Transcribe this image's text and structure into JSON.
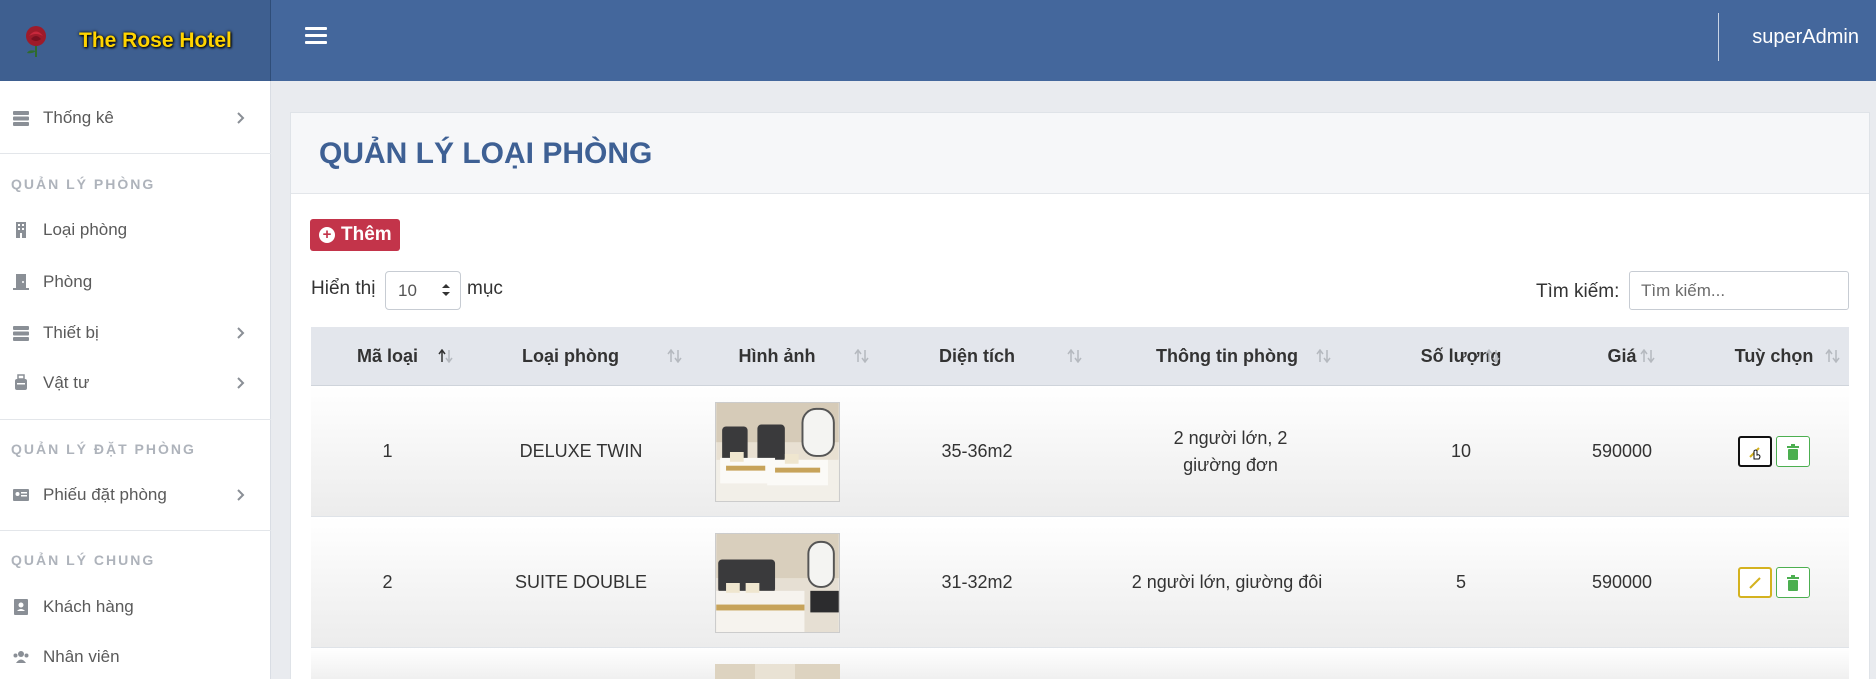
{
  "header": {
    "brand": "The Rose Hotel",
    "user": "superAdmin"
  },
  "sidebar": {
    "stats": "Thống kê",
    "section_rooms": "QUẢN LÝ PHÒNG",
    "room_types": "Loại phòng",
    "rooms": "Phòng",
    "equipment": "Thiết bị",
    "supplies": "Vật tư",
    "section_booking": "QUẢN LÝ ĐẶT PHÒNG",
    "booking_slips": "Phiếu đặt phòng",
    "section_general": "QUẢN LÝ CHUNG",
    "customers": "Khách hàng",
    "staff": "Nhân viên"
  },
  "page": {
    "title": "QUẢN LÝ LOẠI PHÒNG",
    "add_label": "Thêm"
  },
  "controls": {
    "show_label": "Hiển thị",
    "page_size": "10",
    "entries_label": "mục",
    "search_label": "Tìm kiếm:",
    "search_placeholder": "Tìm kiếm..."
  },
  "table": {
    "columns": [
      "Mã loại",
      "Loại phòng",
      "Hình ảnh",
      "Diện tích",
      "Thông tin phòng",
      "Số lượng",
      "Giá",
      "Tuỳ chọn"
    ],
    "rows": [
      {
        "id": "1",
        "type": "DELUXE TWIN",
        "area": "35-36m2",
        "info": "2 người lớn, 2 giường đơn",
        "qty": "10",
        "price": "590000"
      },
      {
        "id": "2",
        "type": "SUITE DOUBLE",
        "area": "31-32m2",
        "info": "2 người lớn, giường đôi",
        "qty": "5",
        "price": "590000"
      }
    ]
  },
  "colors": {
    "header": "#44679c",
    "brand_text": "#ffd400",
    "title": "#3e6094",
    "add_button": "#c3344a",
    "edit": "#d4b21f",
    "delete": "#4caf50"
  }
}
